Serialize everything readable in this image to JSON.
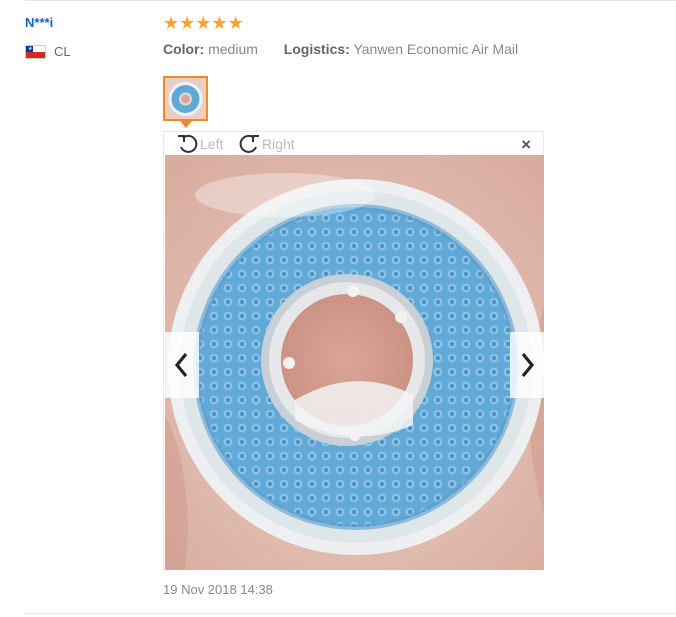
{
  "review": {
    "user_name": "N***i",
    "country_code": "CL",
    "rating": 5,
    "rating_icon": "star-icon",
    "color_label": "Color:",
    "color_value": "medium",
    "logistics_label": "Logistics:",
    "logistics_value": "Yanwen Economic Air Mail",
    "date": "19 Nov 2018 14:38"
  },
  "viewer": {
    "rotate_left_label": "Left",
    "rotate_right_label": "Right",
    "close_glyph": "×"
  },
  "colors": {
    "username": "#1a63b7",
    "stars": "#f5a623",
    "thumb_border": "#f08a24"
  }
}
